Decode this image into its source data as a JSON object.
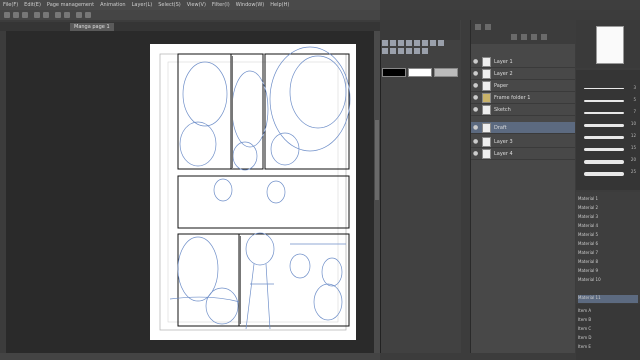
{
  "menu": {
    "items": [
      "File(F)",
      "Edit(E)",
      "Page management",
      "Animation",
      "Layer(L)",
      "Select(S)",
      "View(V)",
      "Filter(I)",
      "Window(W)",
      "Help(H)"
    ]
  },
  "tabs": [
    {
      "label": "Manga page 1"
    }
  ],
  "layers": [
    {
      "name": "Layer 1"
    },
    {
      "name": "Layer 2"
    },
    {
      "name": "Paper"
    },
    {
      "name": "Frame folder 1"
    },
    {
      "name": "Sketch"
    },
    {
      "name": "Draft"
    },
    {
      "name": "Layer 3"
    },
    {
      "name": "Layer 4"
    }
  ],
  "brushes": [
    {
      "size": "3"
    },
    {
      "size": "5"
    },
    {
      "size": "7"
    },
    {
      "size": "10"
    },
    {
      "size": "12"
    },
    {
      "size": "15"
    },
    {
      "size": "20"
    },
    {
      "size": "25"
    }
  ],
  "materials": [
    "Material 1",
    "Material 2",
    "Material 3",
    "Material 4",
    "Material 5",
    "Material 6",
    "Material 7",
    "Material 8",
    "Material 9",
    "Material 10",
    "Material 11"
  ],
  "bottom_items": [
    "Item A",
    "Item B",
    "Item C",
    "Item D",
    "Item E"
  ],
  "colors": {
    "main": "#000000",
    "sub": "#ffffff",
    "accent": "#5c6a80"
  }
}
